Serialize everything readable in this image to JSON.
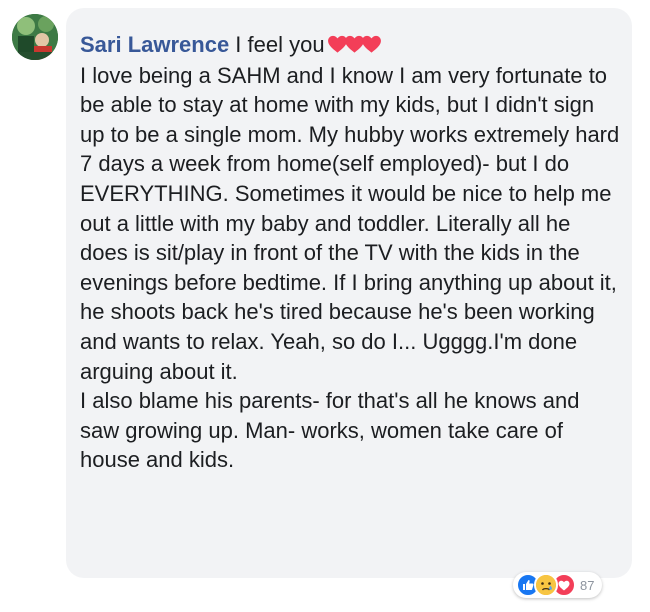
{
  "comment": {
    "author": "Sari Lawrence",
    "inline_text": " I feel you",
    "inline_emoji": [
      "heart-icon",
      "heart-icon",
      "heart-icon"
    ],
    "body": "I love being a SAHM and I know I am very fortunate to be able to stay at home with my kids, but I didn't sign up to be a single mom. My hubby works extremely hard 7 days a week from home(self employed)- but I do EVERYTHING. Sometimes it would be nice to help me out a little with my baby and toddler. Literally all he does is sit/play in front of the TV with the kids in the evenings before bedtime. If I bring anything up about it, he shoots back he's tired because he's been working and wants to relax. Yeah, so do I... Ugggg.I'm done arguing about it.\nI also blame his parents- for that's all he knows and saw growing up. Man- works, women take care of house and kids."
  },
  "reactions": {
    "icons": [
      "like-icon",
      "sad-icon",
      "love-icon"
    ],
    "count": "87"
  },
  "colors": {
    "bubble": "#f2f3f5",
    "author": "#385898",
    "text": "#1c1e21",
    "heart": "#f33e58",
    "like": "#1877f2",
    "sad": "#f7b125",
    "love": "#f33e58"
  }
}
